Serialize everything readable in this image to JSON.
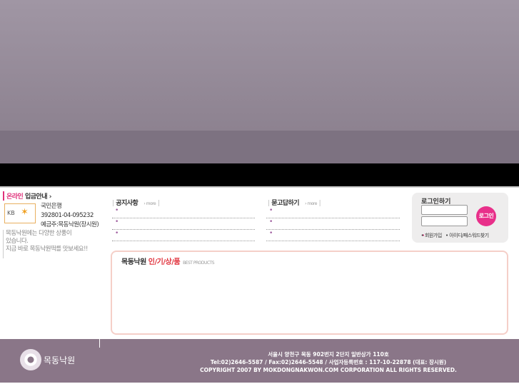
{
  "bank": {
    "title_pink": "온라인",
    "title_rest": " 입금안내 ›",
    "logo": "KB",
    "bank_name": "국민은행",
    "account": "392801-04-095232",
    "holder": "예금주:목동낙원(장시원)",
    "msg1": "목동낙원에는 다양한 상품이",
    "msg2": "있습니다.",
    "msg3": "지금 바로 목동낙원떡를 맛보세요!!"
  },
  "notice": {
    "title": "공지사항",
    "more": "› more",
    "bar": "|"
  },
  "qna": {
    "title": "묻고답하기",
    "more": "› more",
    "bar": "|"
  },
  "bullet": "•",
  "login": {
    "title": "로그인하기",
    "button": "로그인",
    "join": "• 회원가입",
    "find": "• 아이디/패스워드찾기"
  },
  "best": {
    "title": "목동낙원 ",
    "title_red": "인/기/상/품",
    "sub": "BEST PRODUCTS"
  },
  "footer": {
    "logo": "목동낙원",
    "address": "서울시 양천구 목동 902번지 2단지 일반상가 110호",
    "contact": "Tel:02)2646-5587 / Fax:02)2646-5548 / 사업자등록번호 : 117-10-22878 (대표: 장시원)",
    "copyright": "COPYRIGHT 2007 BY MOKDONGNAKWON.COM CORPORATION ALL RIGHTS RESERVED."
  }
}
